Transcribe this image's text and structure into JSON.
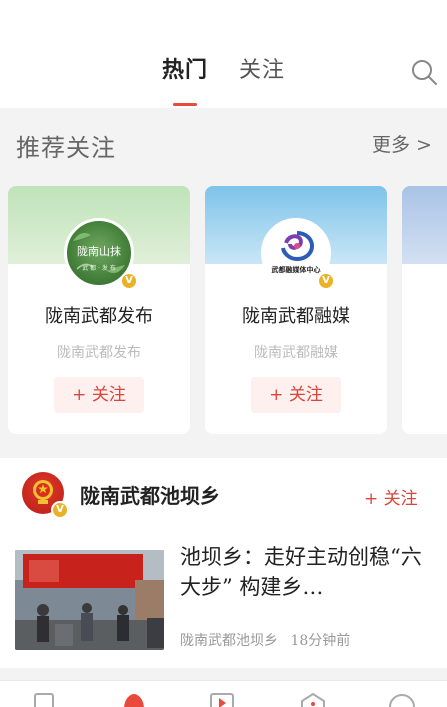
{
  "header": {
    "tabs": [
      {
        "label": "热门",
        "active": true
      },
      {
        "label": "关注",
        "active": false
      }
    ],
    "search_icon": "search-icon",
    "accent": "#e84a3c"
  },
  "recommended": {
    "title": "推荐关注",
    "more": "更多 >",
    "cards": [
      {
        "name": "陇南武都发布",
        "subtitle": "陇南武都发布",
        "avatar_text": "陇南山抹",
        "avatar_sub": "武 都 · 发 布",
        "follow": "+ 关注"
      },
      {
        "name": "陇南武都融媒",
        "subtitle": "陇南武都融媒",
        "avatar_text": "武都融媒体中心",
        "follow": "+ 关注"
      }
    ]
  },
  "news": {
    "source": "陇南武都池坝乡",
    "follow": "+ 关注",
    "headline": "池坝乡：走好主动创稳“六大步” 构建乡…",
    "meta_source": "陇南武都池坝乡",
    "meta_time": "18分钟前"
  },
  "badge": "V"
}
